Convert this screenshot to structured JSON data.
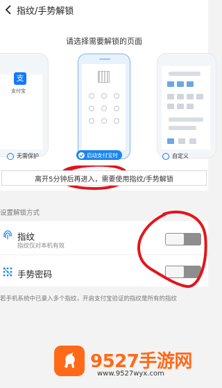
{
  "header": {
    "title": "指纹/手势解锁"
  },
  "chooser": {
    "subtitle": "请选择需要解锁的页面",
    "alipay_label": "支付宝",
    "alipay_logo_char": "支",
    "options": [
      {
        "label": "无需保护",
        "selected": false
      },
      {
        "label": "启动支付宝时",
        "selected": true
      },
      {
        "label": "自定义",
        "selected": false
      }
    ],
    "notice": "离开5分钟后再进入，需要使用指纹/手势解锁"
  },
  "settings": {
    "section_label": "设置解锁方式",
    "fingerprint": {
      "label": "指纹",
      "sub": "指纹仅对本机有效",
      "enabled": false
    },
    "gesture": {
      "label": "手势密码",
      "enabled": false
    }
  },
  "footnote": "若手机系统中已录入多个指纹，开启支付宝验证的指纹是所有的指纹",
  "watermark": {
    "title": "9527手游网",
    "url": "www.9527wyx.com"
  },
  "colors": {
    "accent": "#1b86ee",
    "annotation": "#e5141b",
    "watermark": "#ff6a1a"
  }
}
